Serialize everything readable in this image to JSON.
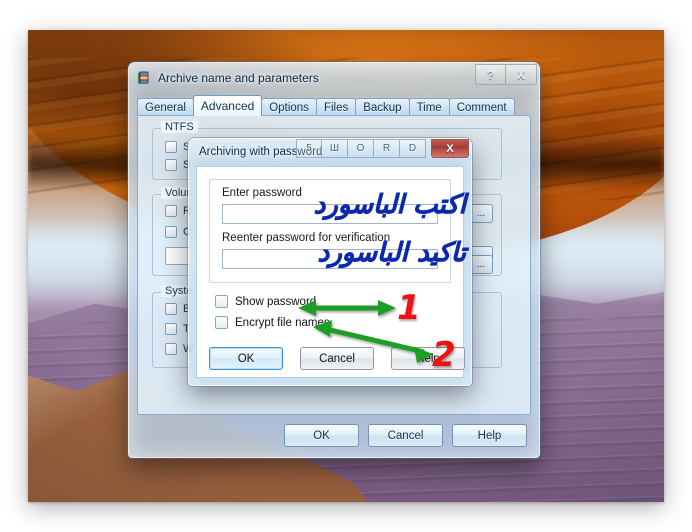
{
  "desktop": {
    "wallpaper_name": "mesa-arch-canyon-wallpaper"
  },
  "main_window": {
    "title": "Archive name and parameters",
    "icon": "winrar-books-icon",
    "titlebar_buttons": [
      {
        "name": "help-button",
        "label": "?"
      },
      {
        "name": "close-button",
        "label": "X"
      }
    ],
    "tabs": [
      {
        "label": "General",
        "active": false
      },
      {
        "label": "Advanced",
        "active": true
      },
      {
        "label": "Options",
        "active": false
      },
      {
        "label": "Files",
        "active": false
      },
      {
        "label": "Backup",
        "active": false
      },
      {
        "label": "Time",
        "active": false
      },
      {
        "label": "Comment",
        "active": false
      }
    ],
    "groups": [
      {
        "label": "NTFS"
      },
      {
        "label": "Volun"
      },
      {
        "label": "Syste"
      }
    ],
    "checkboxes": [
      {
        "label": "S"
      },
      {
        "label": "S"
      },
      {
        "label": "R"
      },
      {
        "label": "C"
      },
      {
        "label": "B"
      },
      {
        "label": "T"
      },
      {
        "label": "W"
      }
    ],
    "browse_buttons": [
      {
        "label": "..."
      },
      {
        "label": "..."
      },
      {
        "label": "..."
      }
    ],
    "buttons": [
      {
        "label": "OK",
        "name": "ok-button"
      },
      {
        "label": "Cancel",
        "name": "cancel-button"
      },
      {
        "label": "Help",
        "name": "help-button"
      }
    ]
  },
  "password_dialog": {
    "title": "Archiving with password",
    "titlebar_letters": [
      "5",
      "Ш",
      "O",
      "R",
      "D"
    ],
    "close_label": "X",
    "enter_password": {
      "label": "Enter password",
      "value": "",
      "overlay_text": "اكتب الباسورد"
    },
    "reenter_password": {
      "label": "Reenter password for verification",
      "value": "",
      "overlay_text": "تاكيد الباسورد"
    },
    "show_password": {
      "label": "Show password",
      "checked": false
    },
    "encrypt_file_names": {
      "label": "Encrypt file names",
      "checked": false
    },
    "buttons": [
      {
        "label": "OK",
        "name": "ok-button",
        "default": true
      },
      {
        "label": "Cancel",
        "name": "cancel-button",
        "default": false
      },
      {
        "label": "Help",
        "name": "help-button",
        "default": false
      }
    ]
  },
  "annotations": {
    "marker_1": "1",
    "marker_2": "2",
    "arrow_color": "#1a9e28",
    "marker_color": "#ee1111"
  }
}
